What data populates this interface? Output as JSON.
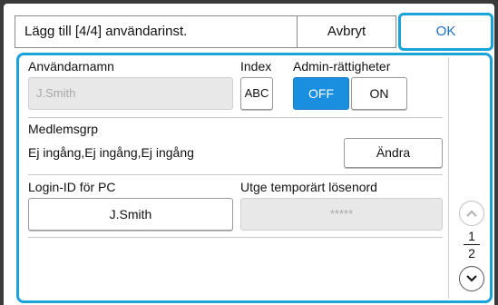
{
  "header": {
    "title": "Lägg till [4/4] användarinst.",
    "cancel_label": "Avbryt",
    "ok_label": "OK"
  },
  "fields": {
    "username_label": "Användarnamn",
    "username_value": "J.Smith",
    "index_label": "Index",
    "index_value": "ABC",
    "admin_label": "Admin-rättigheter",
    "admin_off_label": "OFF",
    "admin_on_label": "ON",
    "admin_selected": "OFF",
    "group_label": "Medlemsgrp",
    "group_value": "Ej ingång,Ej ingång,Ej ingång",
    "change_label": "Ändra",
    "login_label": "Login-ID för PC",
    "login_value": "J.Smith",
    "temp_pw_label": "Utge temporärt lösenord",
    "temp_pw_value": "*****"
  },
  "pager": {
    "current": "1",
    "total": "2",
    "up_icon": "chevron-up-icon",
    "down_icon": "chevron-down-icon"
  },
  "colors": {
    "accent": "#1aa3d8",
    "toggle_active": "#1a8fe0"
  }
}
